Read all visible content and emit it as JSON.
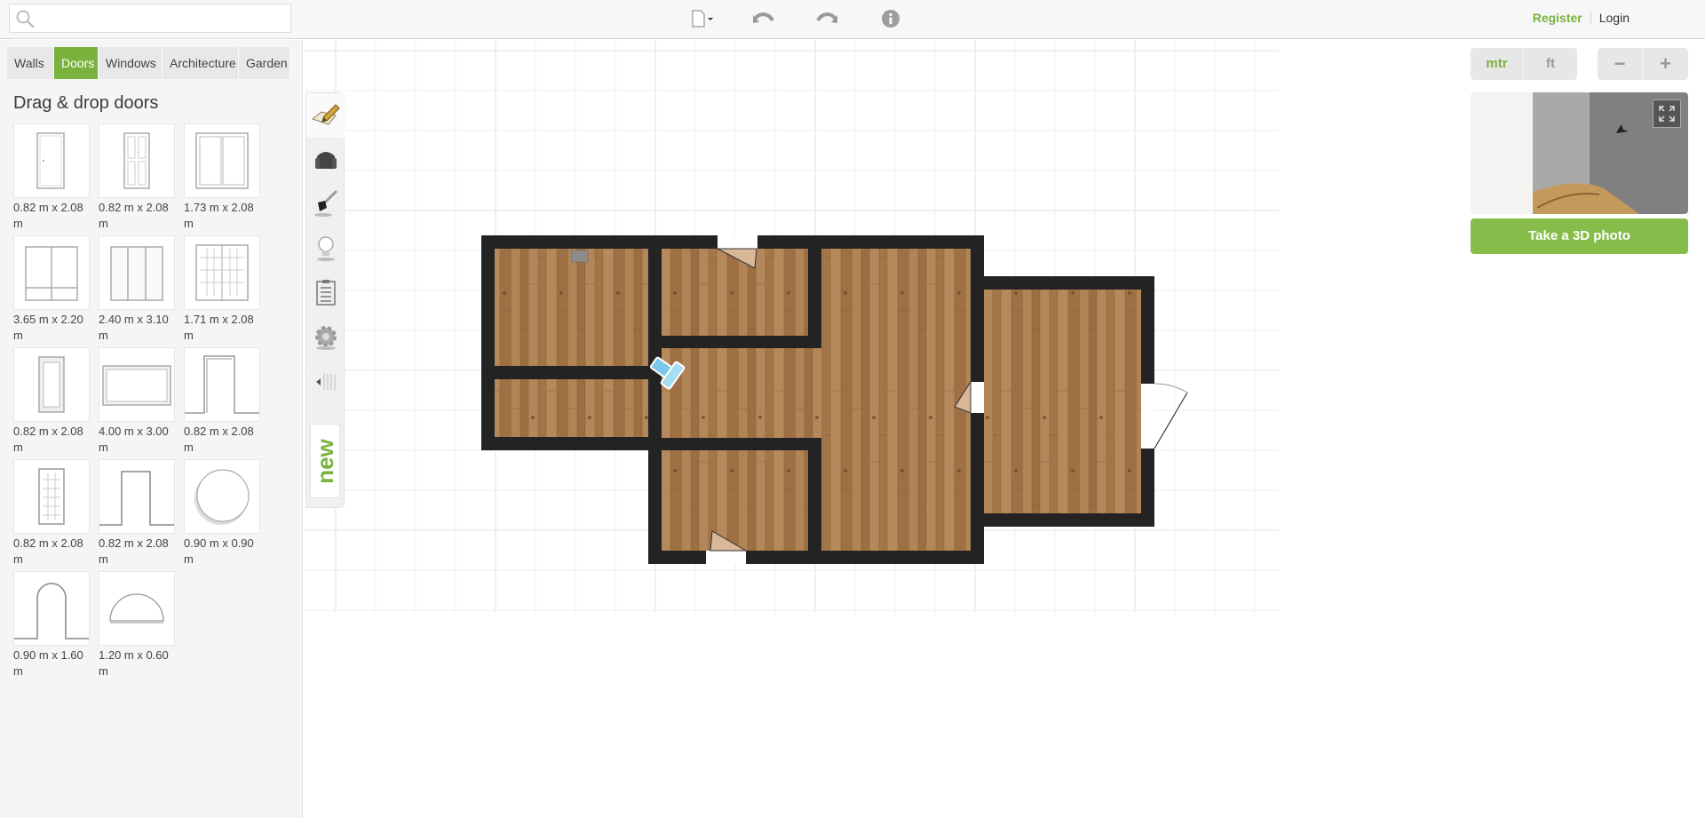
{
  "topbar": {
    "search": {
      "value": "",
      "placeholder": ""
    },
    "icons": [
      "new-file-icon",
      "undo-icon",
      "redo-icon",
      "info-icon"
    ],
    "register_label": "Register",
    "login_label": "Login"
  },
  "left_panel": {
    "tabs": [
      {
        "label": "Walls",
        "active": false
      },
      {
        "label": "Doors",
        "active": true
      },
      {
        "label": "Windows",
        "active": false
      },
      {
        "label": "Architecture",
        "active": false
      },
      {
        "label": "Garden",
        "active": false
      }
    ],
    "title": "Drag & drop doors",
    "doors": [
      {
        "icon": "single-door-icon",
        "label": "0.82 m x 2.08 m"
      },
      {
        "icon": "panel-door-icon",
        "label": "0.82 m x 2.08 m"
      },
      {
        "icon": "double-glass-door-icon",
        "label": "1.73 m x 2.08 m"
      },
      {
        "icon": "sliding-door-wide-icon",
        "label": "3.65 m x 2.20 m"
      },
      {
        "icon": "triple-sliding-door-icon",
        "label": "2.40 m x 3.10 m"
      },
      {
        "icon": "french-door-icon",
        "label": "1.71 m x 2.08 m"
      },
      {
        "icon": "glass-panel-door-icon",
        "label": "0.82 m x 2.08 m"
      },
      {
        "icon": "garage-door-icon",
        "label": "4.00 m x 3.00 m"
      },
      {
        "icon": "doorway-frame-icon",
        "label": "0.82 m x 2.08 m"
      },
      {
        "icon": "grid-glass-door-icon",
        "label": "0.82 m x 2.08 m"
      },
      {
        "icon": "open-doorway-icon",
        "label": "0.82 m x 2.08 m"
      },
      {
        "icon": "round-opening-icon",
        "label": "0.90 m x 0.90 m"
      },
      {
        "icon": "arched-doorway-icon",
        "label": "0.90 m x 1.60 m"
      },
      {
        "icon": "half-round-opening-icon",
        "label": "1.20 m x 0.60 m"
      }
    ]
  },
  "tool_strip": {
    "tools": [
      "floorplan-pencil-icon",
      "armchair-icon",
      "paintbrush-icon",
      "lightbulb-icon",
      "clipboard-list-icon",
      "settings-gear-icon",
      "collapse-arrow-icon"
    ],
    "new_label": "new"
  },
  "right_controls": {
    "units": [
      {
        "label": "mtr",
        "active": true
      },
      {
        "label": "ft",
        "active": false
      }
    ],
    "zoom_out_label": "−",
    "zoom_in_label": "+",
    "take_photo_label": "Take a 3D photo"
  },
  "colors": {
    "accent": "#7ab23e",
    "wall": "#232323",
    "floor": "#a8784a"
  }
}
